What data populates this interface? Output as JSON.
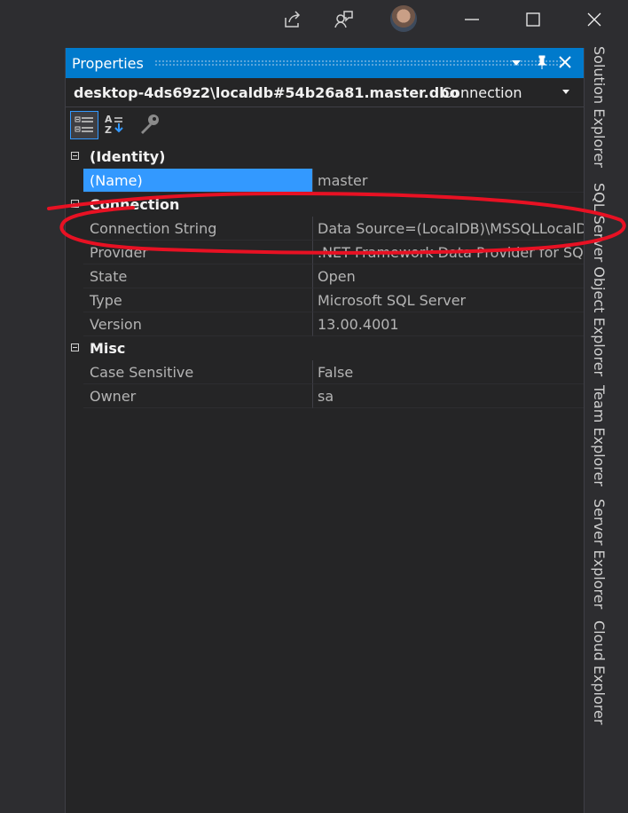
{
  "titlebar": {
    "icons": [
      "share-icon",
      "feedback-icon",
      "user-avatar",
      "minimize-icon",
      "maximize-icon",
      "close-icon"
    ]
  },
  "properties": {
    "title": "Properties",
    "object_name": "desktop-4ds69z2\\localdb#54b26a81.master.dbo",
    "object_type": "Connection",
    "toolbar_icons": [
      "categorized-icon",
      "alphabetical-icon",
      "property-pages-icon"
    ],
    "categories": [
      {
        "label": "(Identity)",
        "rows": [
          {
            "name": "(Name)",
            "value": "master",
            "selected": true
          }
        ]
      },
      {
        "label": "Connection",
        "rows": [
          {
            "name": "Connection String",
            "value": "Data Source=(LocalDB)\\MSSQLLocalD"
          },
          {
            "name": "Provider",
            "value": ".NET Framework Data Provider for SQ"
          },
          {
            "name": "State",
            "value": "Open"
          },
          {
            "name": "Type",
            "value": "Microsoft SQL Server"
          },
          {
            "name": "Version",
            "value": "13.00.4001"
          }
        ]
      },
      {
        "label": "Misc",
        "rows": [
          {
            "name": "Case Sensitive",
            "value": "False"
          },
          {
            "name": "Owner",
            "value": "sa"
          }
        ]
      }
    ]
  },
  "side_tabs": [
    "Solution Explorer",
    "SQL Server Object Explorer",
    "Team Explorer",
    "Server Explorer",
    "Cloud Explorer"
  ],
  "colors": {
    "accent": "#007acc",
    "selection": "#3399ff",
    "background": "#2d2d30",
    "panel": "#252526",
    "annotation": "#e81123"
  }
}
